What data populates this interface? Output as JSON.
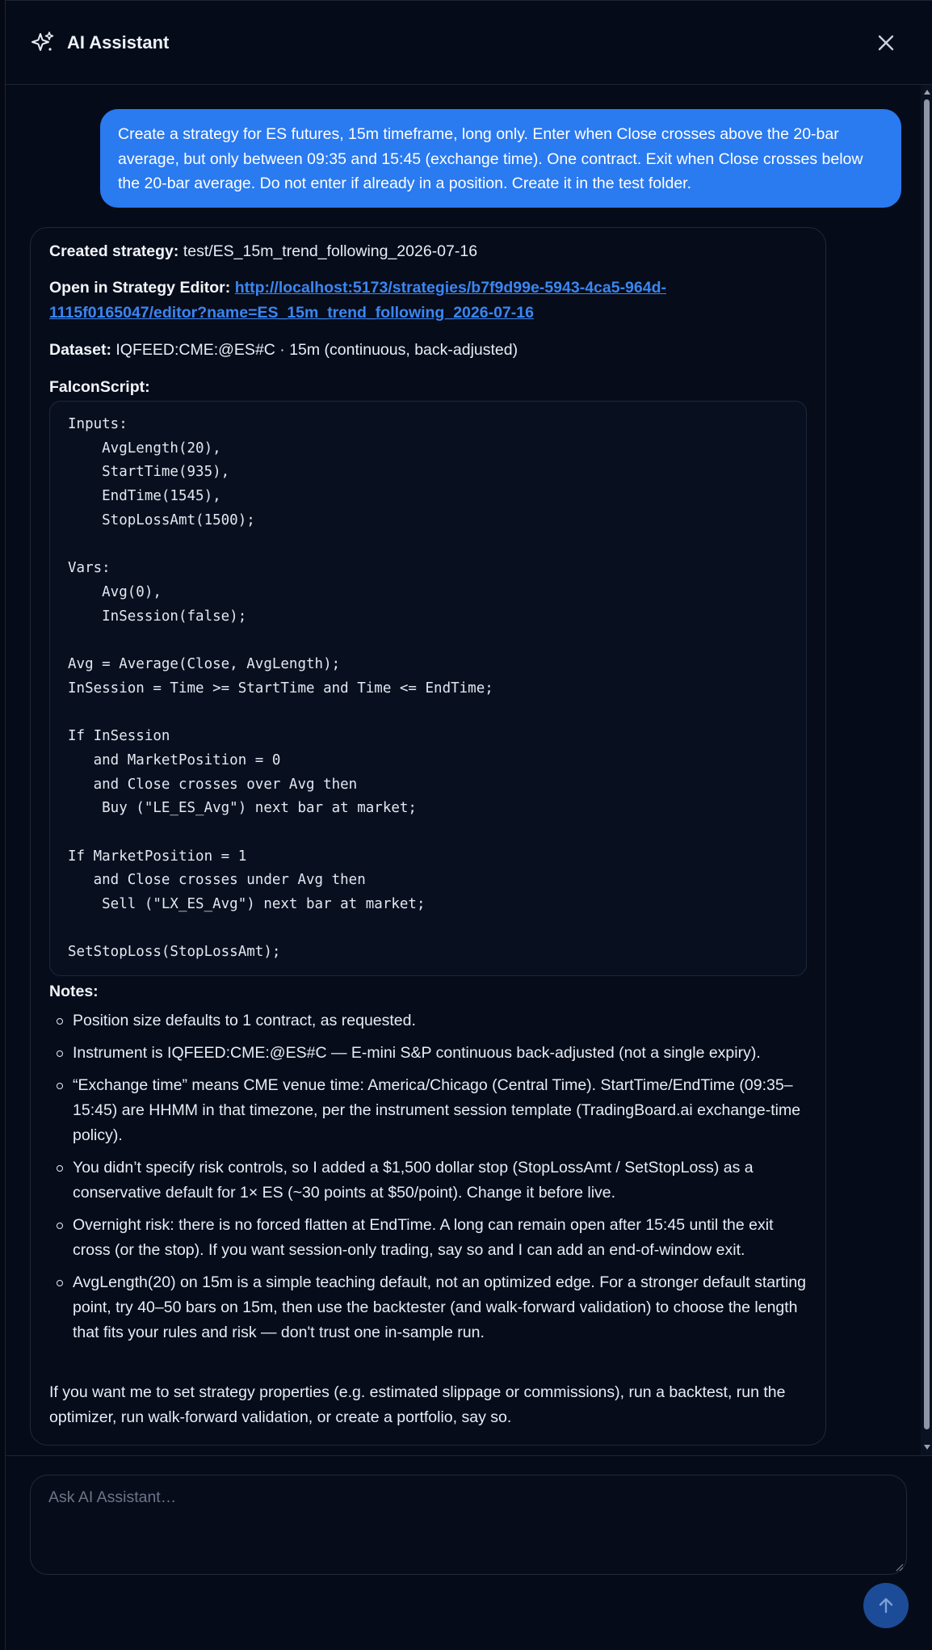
{
  "header": {
    "title": "AI Assistant",
    "icon": "sparkle-icon",
    "close_icon": "close-icon"
  },
  "user_message": "Create a strategy for ES futures, 15m timeframe, long only. Enter when Close crosses above the 20-bar average, but only between 09:35 and 15:45 (exchange time). One contract. Exit when Close crosses below the 20-bar average. Do not enter if already in a position. Create it in the test folder.",
  "reply": {
    "created_label": "Created strategy:",
    "created_value": "test/ES_15m_trend_following_2026-07-16",
    "open_label": "Open in Strategy Editor:",
    "open_link_line1": "http://localhost:5173/strategies/b7f9d99e-5943-4ca5-964d-",
    "open_link_line2": "1115f0165047/editor?name=ES_15m_trend_following_2026-07-16",
    "dataset_label": "Dataset:",
    "dataset_value": "IQFEED:CME:@ES#C · 15m (continuous, back-adjusted)",
    "script_label": "FalconScript:",
    "code": "Inputs:\n    AvgLength(20),\n    StartTime(935),\n    EndTime(1545),\n    StopLossAmt(1500);\n\nVars:\n    Avg(0),\n    InSession(false);\n\nAvg = Average(Close, AvgLength);\nInSession = Time >= StartTime and Time <= EndTime;\n\nIf InSession\n   and MarketPosition = 0\n   and Close crosses over Avg then\n    Buy (\"LE_ES_Avg\") next bar at market;\n\nIf MarketPosition = 1\n   and Close crosses under Avg then\n    Sell (\"LX_ES_Avg\") next bar at market;\n\nSetStopLoss(StopLossAmt);",
    "notes_label": "Notes:",
    "notes": [
      "Position size defaults to 1 contract, as requested.",
      "Instrument is IQFEED:CME:@ES#C — E-mini S&P continuous back-adjusted (not a single expiry).",
      "“Exchange time” means CME venue time: America/Chicago (Central Time). StartTime/EndTime (09:35–15:45) are HHMM in that timezone, per the instrument session template (TradingBoard.ai exchange-time policy).",
      "You didn’t specify risk controls, so I added a $1,500 dollar stop (StopLossAmt / SetStopLoss) as a conservative default for 1× ES (~30 points at $50/point). Change it before live.",
      "Overnight risk: there is no forced flatten at EndTime. A long can remain open after 15:45 until the exit cross (or the stop). If you want session-only trading, say so and I can add an end-of-window exit.",
      "AvgLength(20) on 15m is a simple teaching default, not an optimized edge. For a stronger default starting point, try 40–50 bars on 15m, then use the backtester (and walk-forward validation) to choose the length that fits your rules and risk — don't trust one in-sample run."
    ],
    "closing": "If you want me to set strategy properties (e.g. estimated slippage or commissions), run a backtest, run the optimizer, run walk-forward validation, or create a portfolio, say so."
  },
  "composer": {
    "placeholder": "Ask AI Assistant…",
    "value": "",
    "send_icon": "arrow-up-icon"
  },
  "colors": {
    "background": "#050b19",
    "user_bubble": "#2a7af0",
    "link": "#3b86f2",
    "send_button": "#1c4c98"
  }
}
